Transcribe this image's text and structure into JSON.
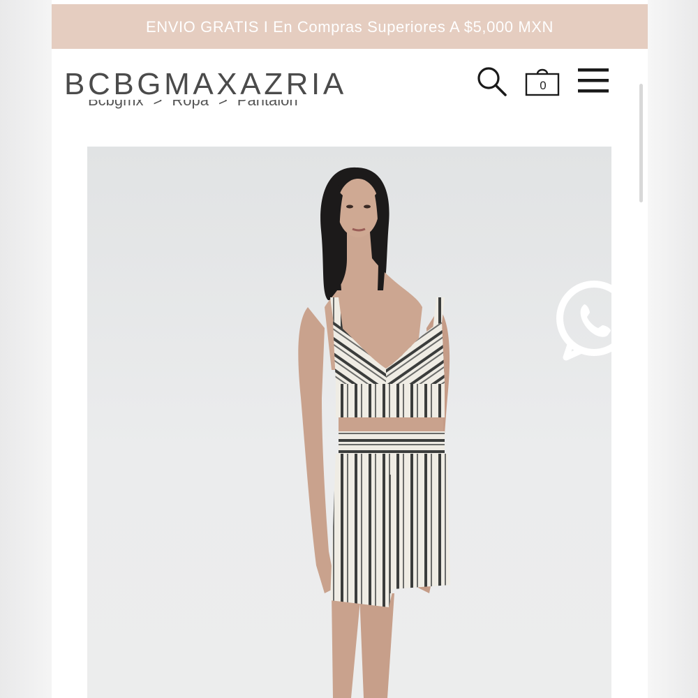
{
  "promo": {
    "text": "ENVIO GRATIS I En Compras Superiores A $5,000 MXN"
  },
  "header": {
    "logo": "BCBGMAXAZRIA",
    "cart_count": "0",
    "icons": [
      "search-icon",
      "shopping-bag-icon",
      "hamburger-menu-icon"
    ]
  },
  "breadcrumb": {
    "items": [
      "Bcbgmx",
      "Ropa",
      "Pantalon"
    ],
    "separator": ">"
  },
  "floating": {
    "icon": "whatsapp-icon",
    "color": "#ffffff"
  },
  "colors": {
    "promo_bar": "#e5cdc0",
    "logo": "#4b4b4b",
    "background": "#ffffff"
  }
}
